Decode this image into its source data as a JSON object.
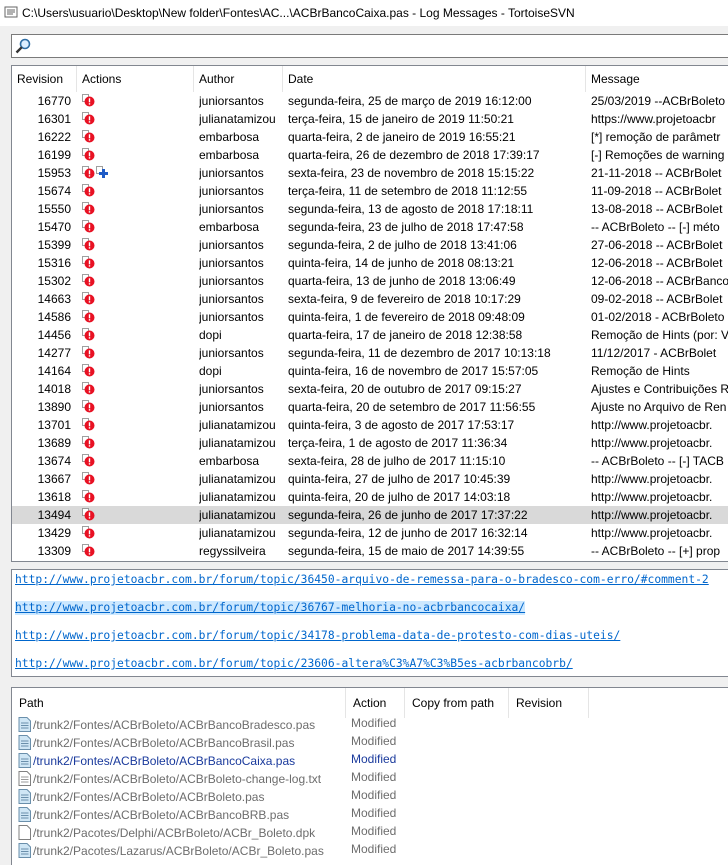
{
  "window": {
    "title": "C:\\Users\\usuario\\Desktop\\New folder\\Fontes\\AC...\\ACBrBancoCaixa.pas - Log Messages - TortoiseSVN"
  },
  "search": {
    "value": "",
    "placeholder": ""
  },
  "log": {
    "columns": {
      "revision": "Revision",
      "actions": "Actions",
      "author": "Author",
      "date": "Date",
      "message": "Message"
    },
    "rows": [
      {
        "revision": "16770",
        "actions": [
          "modified"
        ],
        "author": "juniorsantos",
        "date": "segunda-feira, 25 de março de 2019 16:12:00",
        "message": "25/03/2019 --ACBrBoleto"
      },
      {
        "revision": "16301",
        "actions": [
          "modified"
        ],
        "author": "julianatamizou",
        "date": "terça-feira, 15 de janeiro de 2019 11:50:21",
        "message": "https://www.projetoacbr"
      },
      {
        "revision": "16222",
        "actions": [
          "modified"
        ],
        "author": "embarbosa",
        "date": "quarta-feira, 2 de janeiro de 2019 16:55:21",
        "message": "[*] remoção de parâmetr"
      },
      {
        "revision": "16199",
        "actions": [
          "modified"
        ],
        "author": "embarbosa",
        "date": "quarta-feira, 26 de dezembro de 2018 17:39:17",
        "message": "[-] Remoções de warning"
      },
      {
        "revision": "15953",
        "actions": [
          "modified",
          "added"
        ],
        "author": "juniorsantos",
        "date": "sexta-feira, 23 de novembro de 2018 15:15:22",
        "message": "21-11-2018 -- ACBrBolet"
      },
      {
        "revision": "15674",
        "actions": [
          "modified"
        ],
        "author": "juniorsantos",
        "date": "terça-feira, 11 de setembro de 2018 11:12:55",
        "message": "11-09-2018 -- ACBrBolet"
      },
      {
        "revision": "15550",
        "actions": [
          "modified"
        ],
        "author": "juniorsantos",
        "date": "segunda-feira, 13 de agosto de 2018 17:18:11",
        "message": "13-08-2018 -- ACBrBolet"
      },
      {
        "revision": "15470",
        "actions": [
          "modified"
        ],
        "author": "embarbosa",
        "date": "segunda-feira, 23 de julho de 2018 17:47:58",
        "message": "-- ACBrBoleto -- [-] méto"
      },
      {
        "revision": "15399",
        "actions": [
          "modified"
        ],
        "author": "juniorsantos",
        "date": "segunda-feira, 2 de julho de 2018 13:41:06",
        "message": "27-06-2018 -- ACBrBolet"
      },
      {
        "revision": "15316",
        "actions": [
          "modified"
        ],
        "author": "juniorsantos",
        "date": "quinta-feira, 14 de junho de 2018 08:13:21",
        "message": "12-06-2018 -- ACBrBolet"
      },
      {
        "revision": "15302",
        "actions": [
          "modified"
        ],
        "author": "juniorsantos",
        "date": "quarta-feira, 13 de junho de 2018 13:06:49",
        "message": "12-06-2018 -- ACBrBanco"
      },
      {
        "revision": "14663",
        "actions": [
          "modified"
        ],
        "author": "juniorsantos",
        "date": "sexta-feira, 9 de fevereiro de 2018 10:17:29",
        "message": "09-02-2018 -- ACBrBolet"
      },
      {
        "revision": "14586",
        "actions": [
          "modified"
        ],
        "author": "juniorsantos",
        "date": "quinta-feira, 1 de fevereiro de 2018 09:48:09",
        "message": "01-02/2018 - ACBrBoleto"
      },
      {
        "revision": "14456",
        "actions": [
          "modified"
        ],
        "author": "dopi",
        "date": "quarta-feira, 17 de janeiro de 2018 12:38:58",
        "message": "Remoção de Hints (por: V"
      },
      {
        "revision": "14277",
        "actions": [
          "modified"
        ],
        "author": "juniorsantos",
        "date": "segunda-feira, 11 de dezembro de 2017 10:13:18",
        "message": "11/12/2017 - ACBrBolet"
      },
      {
        "revision": "14164",
        "actions": [
          "modified"
        ],
        "author": "dopi",
        "date": "quinta-feira, 16 de novembro de 2017 15:57:05",
        "message": "Remoção de Hints"
      },
      {
        "revision": "14018",
        "actions": [
          "modified"
        ],
        "author": "juniorsantos",
        "date": "sexta-feira, 20 de outubro de 2017 09:15:27",
        "message": "Ajustes e Contribuições R"
      },
      {
        "revision": "13890",
        "actions": [
          "modified"
        ],
        "author": "juniorsantos",
        "date": "quarta-feira, 20 de setembro de 2017 11:56:55",
        "message": "Ajuste no Arquivo de Ren"
      },
      {
        "revision": "13701",
        "actions": [
          "modified"
        ],
        "author": "julianatamizou",
        "date": "quinta-feira, 3 de agosto de 2017 17:53:17",
        "message": "http://www.projetoacbr."
      },
      {
        "revision": "13689",
        "actions": [
          "modified"
        ],
        "author": "julianatamizou",
        "date": "terça-feira, 1 de agosto de 2017 11:36:34",
        "message": "http://www.projetoacbr."
      },
      {
        "revision": "13674",
        "actions": [
          "modified"
        ],
        "author": "embarbosa",
        "date": "sexta-feira, 28 de julho de 2017 11:15:10",
        "message": "-- ACBrBoleto -- [-] TACB"
      },
      {
        "revision": "13667",
        "actions": [
          "modified"
        ],
        "author": "julianatamizou",
        "date": "quinta-feira, 27 de julho de 2017 10:45:39",
        "message": "http://www.projetoacbr."
      },
      {
        "revision": "13618",
        "actions": [
          "modified"
        ],
        "author": "julianatamizou",
        "date": "quinta-feira, 20 de julho de 2017 14:03:18",
        "message": "http://www.projetoacbr."
      },
      {
        "revision": "13494",
        "actions": [
          "modified"
        ],
        "author": "julianatamizou",
        "date": "segunda-feira, 26 de junho de 2017 17:37:22",
        "message": "http://www.projetoacbr.",
        "selected": true
      },
      {
        "revision": "13429",
        "actions": [
          "modified"
        ],
        "author": "julianatamizou",
        "date": "segunda-feira, 12 de junho de 2017 16:32:14",
        "message": "http://www.projetoacbr."
      },
      {
        "revision": "13309",
        "actions": [
          "modified"
        ],
        "author": "regyssilveira",
        "date": "segunda-feira, 15 de maio de 2017 14:39:55",
        "message": "-- ACBrBoleto -- [+] prop"
      }
    ]
  },
  "message": {
    "lines": [
      "http://www.projetoacbr.com.br/forum/topic/36450-arquivo-de-remessa-para-o-bradesco-com-erro/#comment-2",
      "http://www.projetoacbr.com.br/forum/topic/36767-melhoria-no-acbrbancocaixa/",
      "http://www.projetoacbr.com.br/forum/topic/34178-problema-data-de-protesto-com-dias-uteis/",
      "http://www.projetoacbr.com.br/forum/topic/23606-altera%C3%A7%C3%B5es-acbrbancobrb/"
    ],
    "highlighted_index": 1
  },
  "paths": {
    "columns": {
      "path": "Path",
      "action": "Action",
      "copy_from": "Copy from path",
      "revision": "Revision"
    },
    "rows": [
      {
        "path": "/trunk2/Fontes/ACBrBoleto/ACBrBancoBradesco.pas",
        "action": "Modified",
        "icon": "pascal-file-icon",
        "changed": false
      },
      {
        "path": "/trunk2/Fontes/ACBrBoleto/ACBrBancoBrasil.pas",
        "action": "Modified",
        "icon": "pascal-file-icon",
        "changed": false
      },
      {
        "path": "/trunk2/Fontes/ACBrBoleto/ACBrBancoCaixa.pas",
        "action": "Modified",
        "icon": "pascal-file-icon",
        "changed": true
      },
      {
        "path": "/trunk2/Fontes/ACBrBoleto/ACBrBoleto-change-log.txt",
        "action": "Modified",
        "icon": "text-file-icon",
        "changed": false
      },
      {
        "path": "/trunk2/Fontes/ACBrBoleto/ACBrBoleto.pas",
        "action": "Modified",
        "icon": "pascal-file-icon",
        "changed": false
      },
      {
        "path": "/trunk2/Fontes/ACBrBoleto/ACBrBancoBRB.pas",
        "action": "Modified",
        "icon": "pascal-file-icon",
        "changed": false
      },
      {
        "path": "/trunk2/Pacotes/Delphi/ACBrBoleto/ACBr_Boleto.dpk",
        "action": "Modified",
        "icon": "blank-file-icon",
        "changed": false
      },
      {
        "path": "/trunk2/Pacotes/Lazarus/ACBrBoleto/ACBr_Boleto.pas",
        "action": "Modified",
        "icon": "pascal-file-icon",
        "changed": false
      }
    ]
  },
  "colors": {
    "modified_action": "#e81123",
    "added_action": "#1e5bc6",
    "link": "#0066cc",
    "changed_path": "#1a3a9c",
    "selection": "#d9d9d9",
    "highlight": "#cce8ff"
  }
}
